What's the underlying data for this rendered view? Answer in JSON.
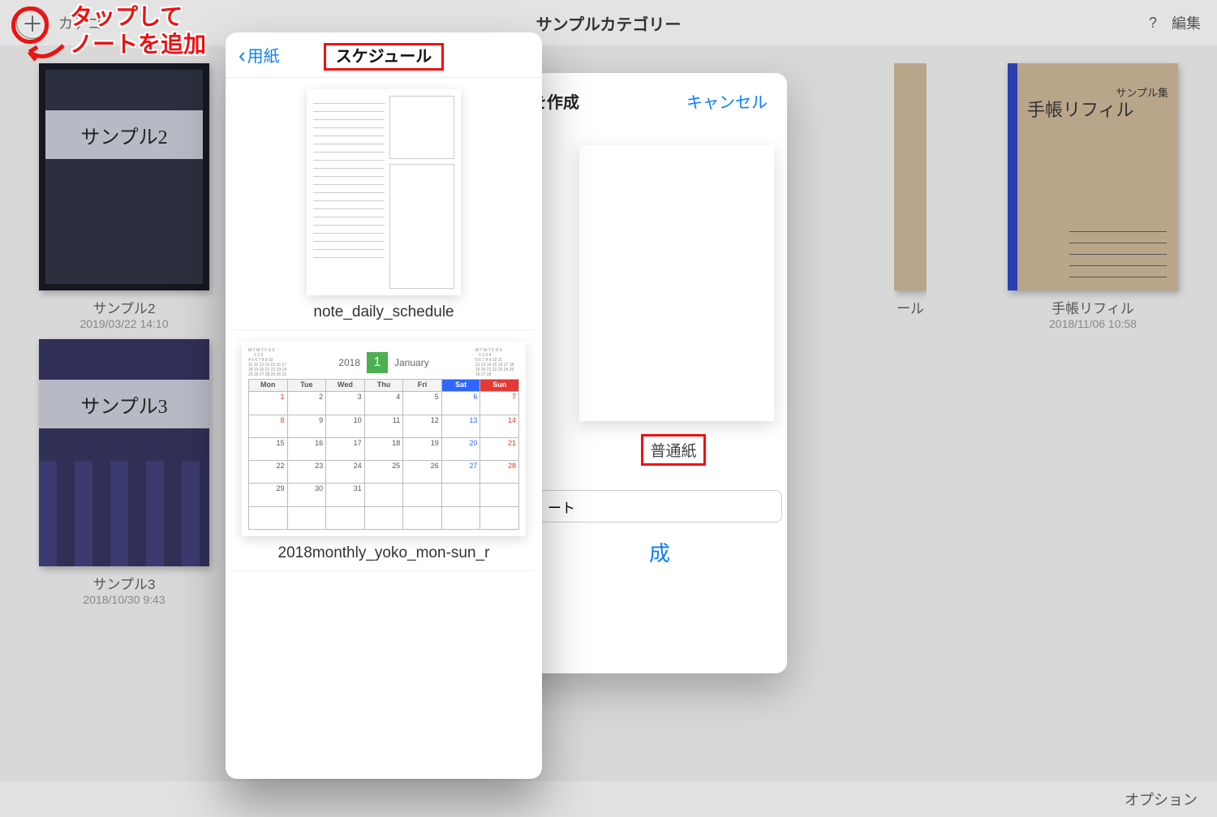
{
  "toolbar": {
    "title": "サンプルカテゴリー",
    "category_label": "カテゴ",
    "help": "?",
    "edit": "編集"
  },
  "annotation": {
    "line1": "タップして",
    "line2": "ノートを追加"
  },
  "library": {
    "notes": [
      {
        "title": "サンプル2",
        "date": "2019/03/22 14:10",
        "cover_text": "サンプル2"
      },
      {
        "title": "サンプル3",
        "date": "2018/10/30 9:43",
        "cover_text": "サンプル3"
      },
      {
        "title": "手帳リフィル",
        "date": "2018/11/06 10:58",
        "cover_text": "手帳リフィル",
        "cover_sub": "サンプル集"
      }
    ],
    "hidden_card": {
      "title_suffix": "ール"
    }
  },
  "bottom": {
    "options": "オプション"
  },
  "sheet_create": {
    "title_suffix": "を作成",
    "cancel": "キャンセル",
    "paper_label": "普通紙",
    "name_placeholder": "ート",
    "create_suffix": "成"
  },
  "sheet_templates": {
    "back": "用紙",
    "title": "スケジュール",
    "items": [
      {
        "name": "note_daily_schedule"
      },
      {
        "name": "2018monthly_yoko_mon-sun_r"
      }
    ],
    "calendar": {
      "year": "2018",
      "month_num": "1",
      "month_name": "January",
      "dow": [
        "Mon",
        "Tue",
        "Wed",
        "Thu",
        "Fri",
        "Sat",
        "Sun"
      ],
      "weeks": [
        [
          "1",
          "2",
          "3",
          "4",
          "5",
          "6",
          "7"
        ],
        [
          "8",
          "9",
          "10",
          "11",
          "12",
          "13",
          "14"
        ],
        [
          "15",
          "16",
          "17",
          "18",
          "19",
          "20",
          "21"
        ],
        [
          "22",
          "23",
          "24",
          "25",
          "26",
          "27",
          "28"
        ],
        [
          "29",
          "30",
          "31",
          "",
          "",
          "",
          ""
        ],
        [
          "",
          "",
          "",
          "",
          "",
          "",
          ""
        ]
      ]
    }
  }
}
